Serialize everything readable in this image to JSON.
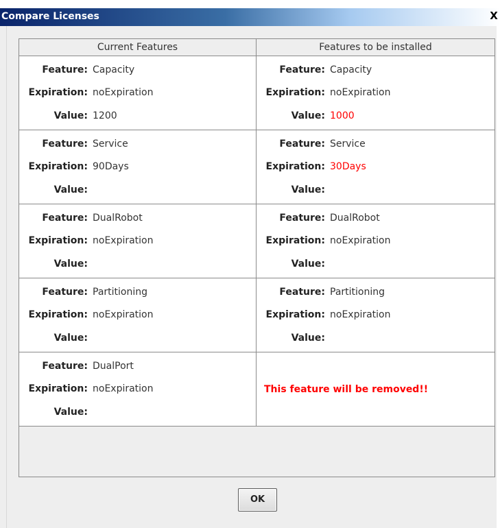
{
  "window": {
    "title": "Compare Licenses",
    "close_label": "X"
  },
  "headers": {
    "current": "Current Features",
    "install": "Features to be installed"
  },
  "labels": {
    "feature": "Feature:",
    "expiration": "Expiration:",
    "value": "Value:"
  },
  "rows": [
    {
      "current": {
        "feature": "Capacity",
        "expiration": "noExpiration",
        "value": "1200"
      },
      "install": {
        "feature": "Capacity",
        "expiration": "noExpiration",
        "value": "1000"
      }
    },
    {
      "current": {
        "feature": "Service",
        "expiration": "90Days",
        "value": ""
      },
      "install": {
        "feature": "Service",
        "expiration": "30Days",
        "value": ""
      }
    },
    {
      "current": {
        "feature": "DualRobot",
        "expiration": "noExpiration",
        "value": ""
      },
      "install": {
        "feature": "DualRobot",
        "expiration": "noExpiration",
        "value": ""
      }
    },
    {
      "current": {
        "feature": "Partitioning",
        "expiration": "noExpiration",
        "value": ""
      },
      "install": {
        "feature": "Partitioning",
        "expiration": "noExpiration",
        "value": ""
      }
    },
    {
      "current": {
        "feature": "DualPort",
        "expiration": "noExpiration",
        "value": ""
      },
      "install": {
        "removed_message": "This feature will be removed!!"
      }
    }
  ],
  "ok_label": "OK",
  "colors": {
    "changed": "#ff0000",
    "titlebar": "#0a246a"
  }
}
